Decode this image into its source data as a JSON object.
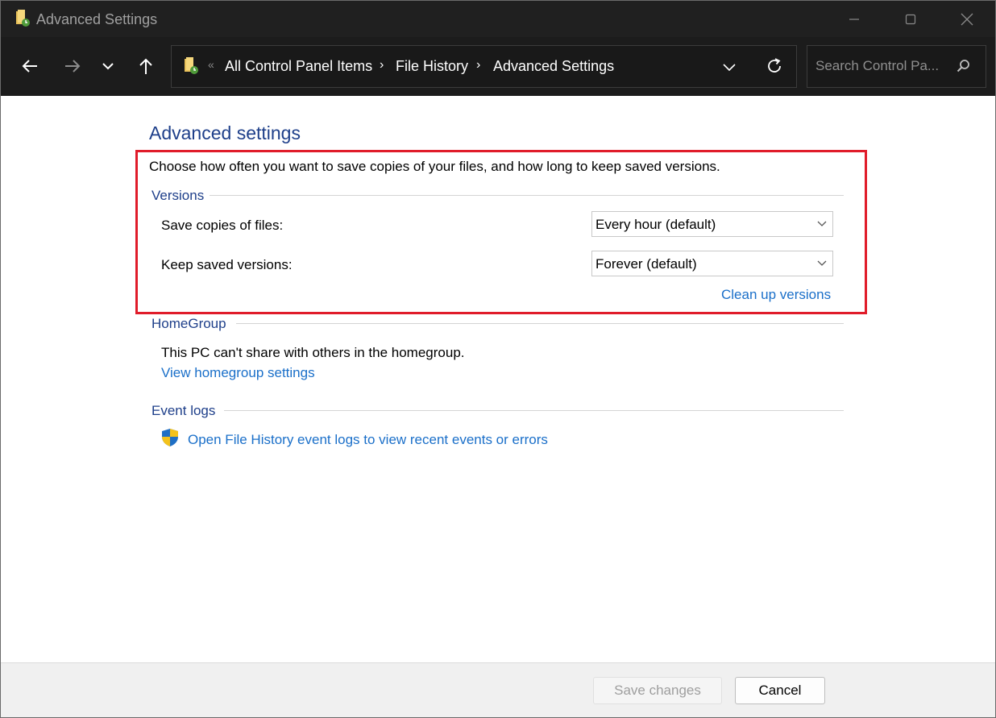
{
  "window": {
    "title": "Advanced Settings"
  },
  "navigation": {
    "breadcrumbs": [
      "All Control Panel Items",
      "File History",
      "Advanced Settings"
    ],
    "search_placeholder": "Search Control Pa..."
  },
  "page": {
    "title": "Advanced settings",
    "description": "Choose how often you want to save copies of your files, and how long to keep saved versions.",
    "versions": {
      "heading": "Versions",
      "save_copies_label": "Save copies of files:",
      "save_copies_value": "Every hour (default)",
      "keep_versions_label": "Keep saved versions:",
      "keep_versions_value": "Forever (default)",
      "clean_up_link": "Clean up versions"
    },
    "homegroup": {
      "heading": "HomeGroup",
      "status": "This PC can't share with others in the homegroup.",
      "link": "View homegroup settings"
    },
    "event_logs": {
      "heading": "Event logs",
      "link": "Open File History event logs to view recent events or errors"
    }
  },
  "footer": {
    "save_label": "Save changes",
    "cancel_label": "Cancel"
  },
  "colors": {
    "accent_link": "#1a6fc9",
    "heading_blue": "#1e3f8a",
    "highlight_border": "#e01c2a",
    "titlebar_bg": "#202020"
  }
}
